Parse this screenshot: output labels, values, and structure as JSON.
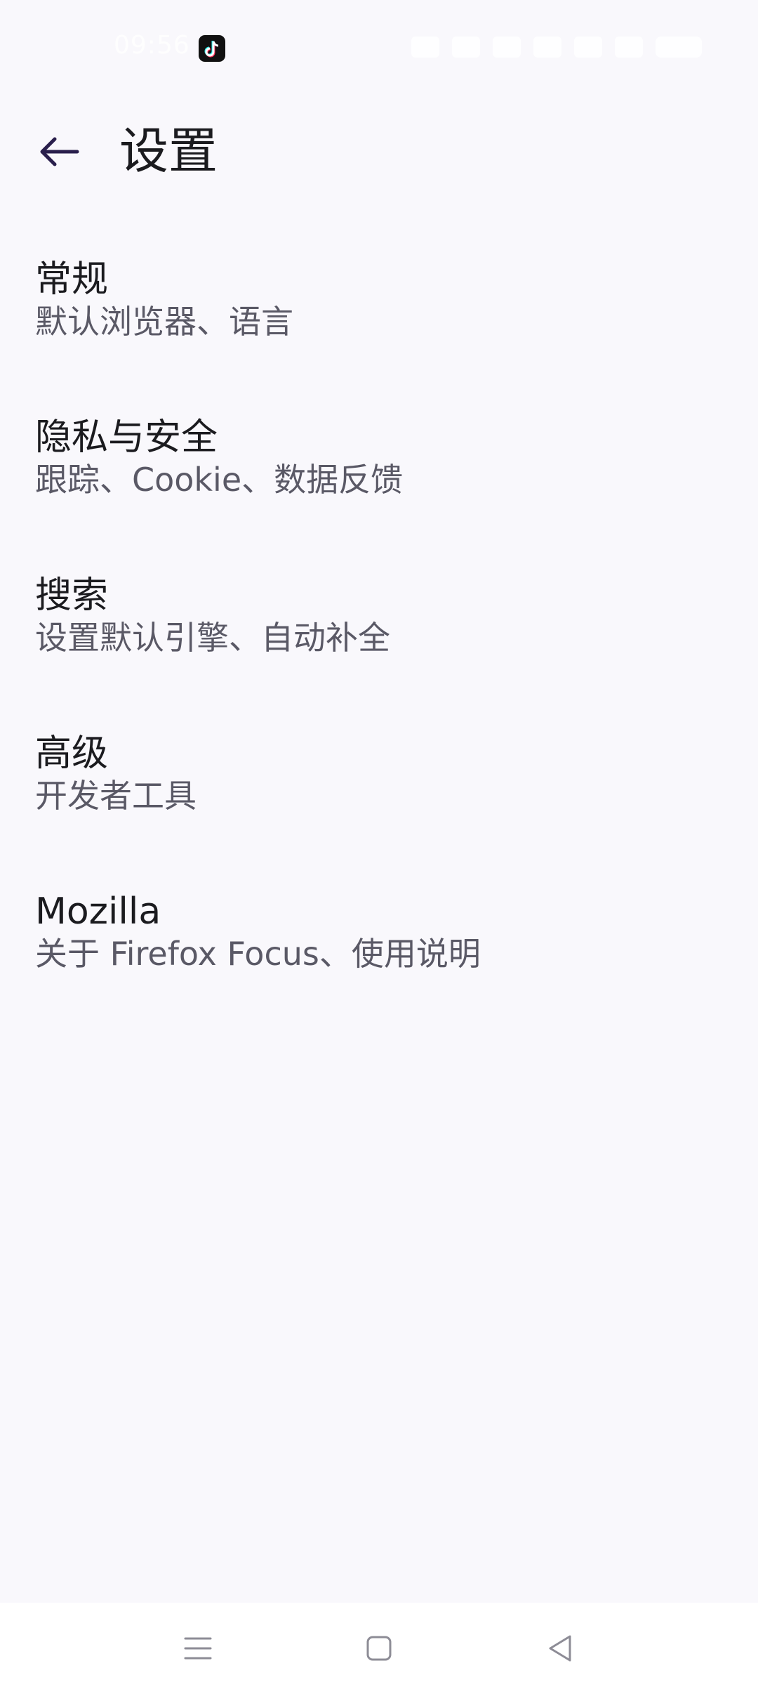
{
  "status_bar": {
    "time": "09:56",
    "app_icon": "tiktok-icon"
  },
  "app_bar": {
    "title": "设置",
    "back_icon": "arrow-left-icon"
  },
  "settings": [
    {
      "title": "常规",
      "summary": "默认浏览器、语言"
    },
    {
      "title": "隐私与安全",
      "summary": "跟踪、Cookie、数据反馈"
    },
    {
      "title": "搜索",
      "summary": "设置默认引擎、自动补全"
    },
    {
      "title": "高级",
      "summary": "开发者工具"
    },
    {
      "title": "Mozilla",
      "summary": "关于 Firefox Focus、使用说明"
    }
  ],
  "nav_bar": {
    "menu_icon": "menu-icon",
    "home_icon": "home-square-icon",
    "back_icon": "back-triangle-icon"
  },
  "colors": {
    "background": "#f9f8fc",
    "text_primary": "#1b1b1f",
    "text_secondary": "#5a5966",
    "back_arrow": "#2a1f4c"
  }
}
